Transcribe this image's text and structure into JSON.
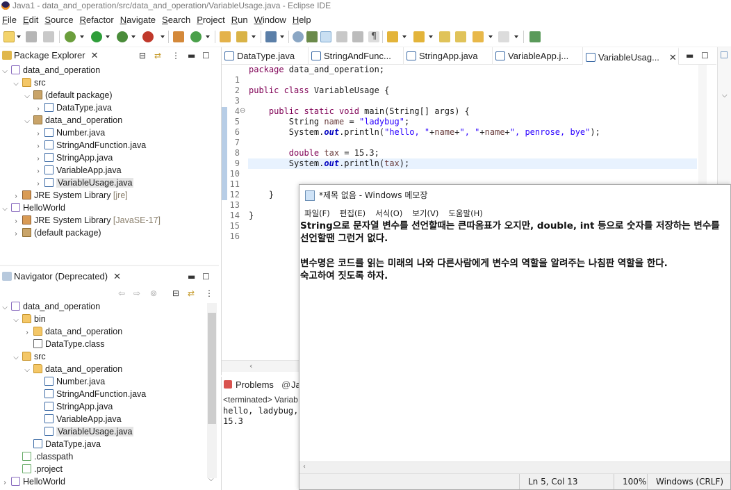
{
  "window": {
    "title": "Java1 - data_and_operation/src/data_and_operation/VariableUsage.java - Eclipse IDE"
  },
  "menu": [
    "File",
    "Edit",
    "Source",
    "Refactor",
    "Navigate",
    "Search",
    "Project",
    "Run",
    "Window",
    "Help"
  ],
  "package_explorer": {
    "title": "Package Explorer",
    "rows": [
      {
        "label": "data_and_operation",
        "suffix": ""
      },
      {
        "label": "src",
        "suffix": ""
      },
      {
        "label": "(default package)",
        "suffix": ""
      },
      {
        "label": "DataType.java",
        "suffix": ""
      },
      {
        "label": "data_and_operation",
        "suffix": ""
      },
      {
        "label": "Number.java",
        "suffix": ""
      },
      {
        "label": "StringAndFunction.java",
        "suffix": ""
      },
      {
        "label": "StringApp.java",
        "suffix": ""
      },
      {
        "label": "VariableApp.java",
        "suffix": ""
      },
      {
        "label": "VariableUsage.java",
        "suffix": ""
      },
      {
        "label": "JRE System Library ",
        "suffix": "[jre]"
      },
      {
        "label": "HelloWorld",
        "suffix": ""
      },
      {
        "label": "JRE System Library ",
        "suffix": "[JavaSE-17]"
      },
      {
        "label": "(default package)",
        "suffix": ""
      }
    ]
  },
  "navigator": {
    "title": "Navigator (Deprecated)",
    "rows": [
      {
        "label": "data_and_operation"
      },
      {
        "label": "bin"
      },
      {
        "label": "data_and_operation"
      },
      {
        "label": "DataType.class"
      },
      {
        "label": "src"
      },
      {
        "label": "data_and_operation"
      },
      {
        "label": "Number.java"
      },
      {
        "label": "StringAndFunction.java"
      },
      {
        "label": "StringApp.java"
      },
      {
        "label": "VariableApp.java"
      },
      {
        "label": "VariableUsage.java"
      },
      {
        "label": "DataType.java"
      },
      {
        "label": ".classpath"
      },
      {
        "label": ".project"
      },
      {
        "label": "HelloWorld"
      }
    ]
  },
  "editor": {
    "tabs": [
      "DataType.java",
      "StringAndFunc...",
      "StringApp.java",
      "VariableApp.j...",
      "VariableUsag..."
    ],
    "line_numbers": [
      "1",
      "2",
      "3",
      "4",
      "5",
      "6",
      "7",
      "8",
      "9",
      "10",
      "11",
      "12",
      "13",
      "14",
      "15",
      "16"
    ],
    "code": {
      "l1_kw": "package",
      "l1_rest": " data_and_operation;",
      "l3_kw": "public class",
      "l3_rest": " VariableUsage {",
      "l5_kw": "public static void",
      "l5_rest": " main(String[] args) {",
      "l6_a": "String ",
      "l6_var": "name",
      "l6_b": " = ",
      "l6_str": "\"ladybug\"",
      "l6_c": ";",
      "l7_a": "System.",
      "l7_out": "out",
      "l7_b": ".println(",
      "l7_s1": "\"hello, \"",
      "l7_c": "+",
      "l7_v1": "name",
      "l7_d": "+",
      "l7_s2": "\", \"",
      "l7_e": "+",
      "l7_v2": "name",
      "l7_f": "+",
      "l7_s3": "\", penrose, bye\"",
      "l7_g": ");",
      "l9_kw": "double",
      "l9_a": " ",
      "l9_var": "tax",
      "l9_b": " = 15.3;",
      "l10_a": "System.",
      "l10_out": "out",
      "l10_b": ".println(",
      "l10_var": "tax",
      "l10_c": ");",
      "l13": "}",
      "l15": "}"
    }
  },
  "console": {
    "tabs": [
      "Problems",
      "Ja"
    ],
    "terminated": "<terminated> Variab",
    "output": [
      "hello, ladybug,",
      "15.3"
    ]
  },
  "notepad": {
    "title": "*제목 없음 - Windows 메모장",
    "menu": [
      "파일(F)",
      "편집(E)",
      "서식(O)",
      "보기(V)",
      "도움말(H)"
    ],
    "text": "String으로 문자열 변수를 선언할때는 큰따옴표가 오지만, double, int 등으로 숫자를 저장하는 변수를\n선언할땐 그런거 없다.\n\n변수명은 코드를 읽는 미래의 나와 다른사람에게 변수의 역할을 알려주는 나침판 역할을 한다.\n숙고하여 짓도록 하자.",
    "status": {
      "position": "Ln 5, Col 13",
      "zoom": "100%",
      "eol": "Windows (CRLF)"
    }
  }
}
